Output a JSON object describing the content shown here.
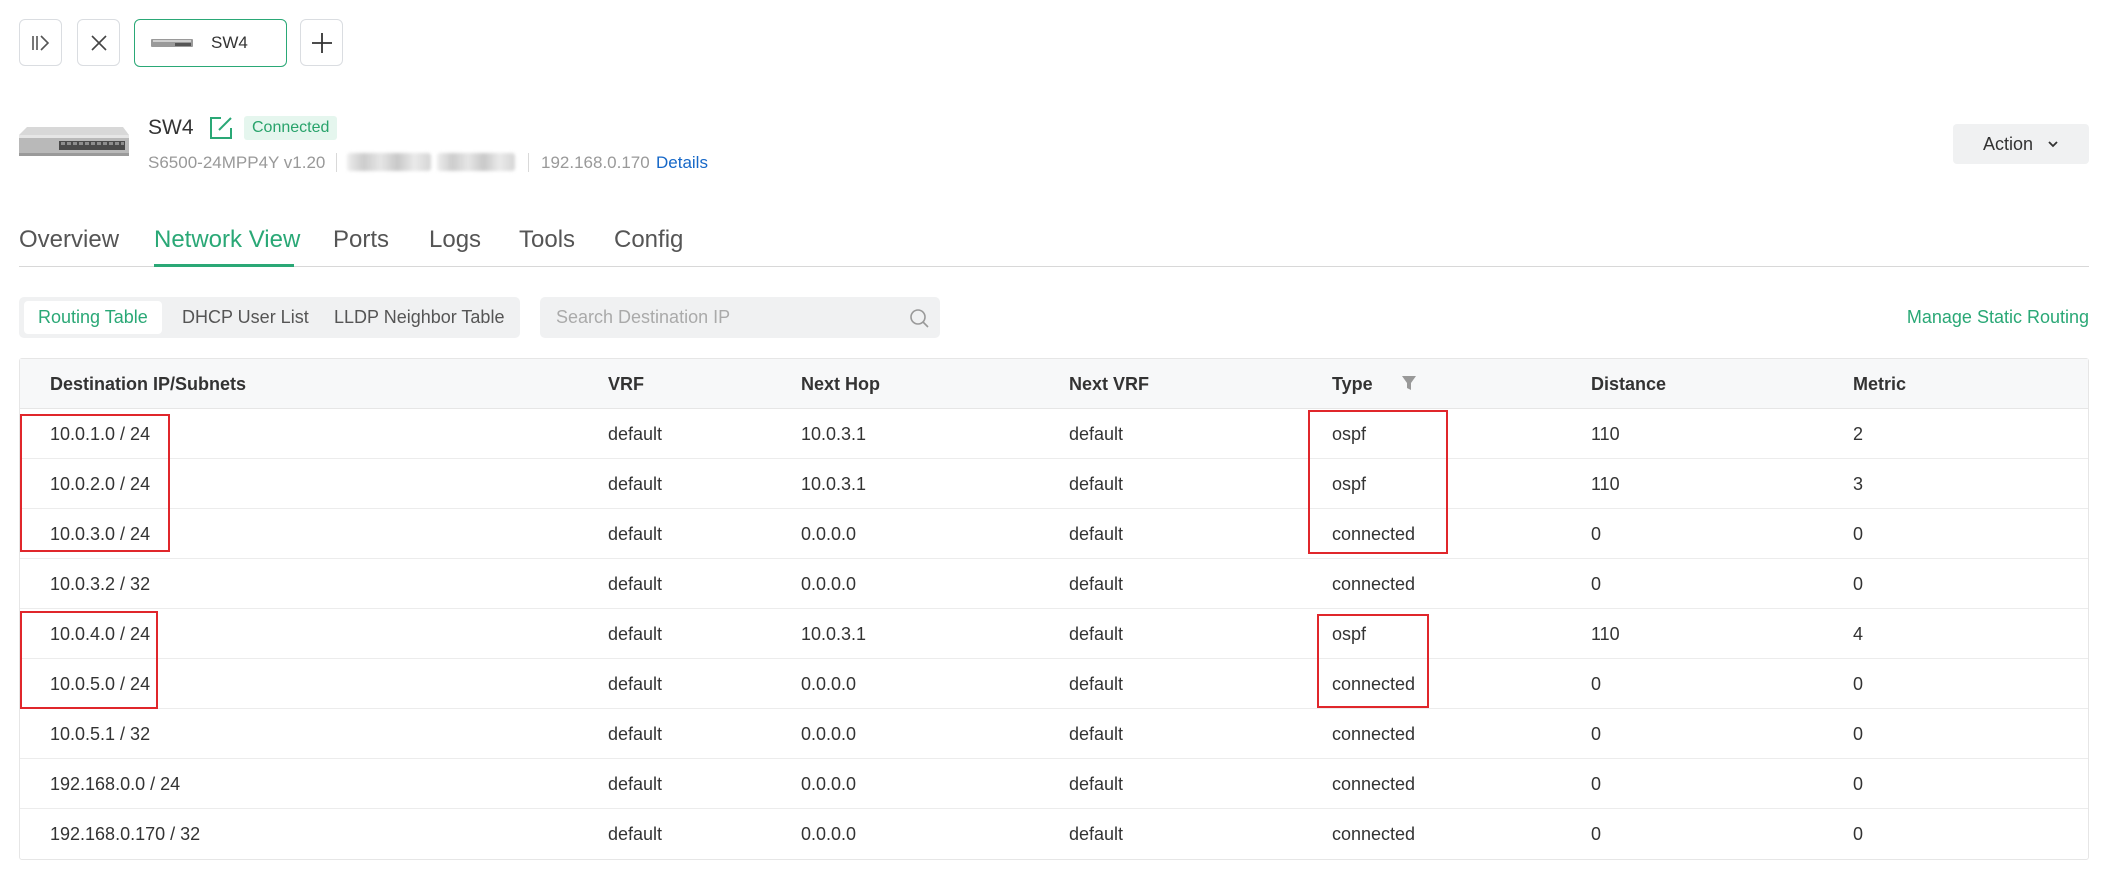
{
  "tabstrip": {
    "device_tab_label": "SW4"
  },
  "device": {
    "name": "SW4",
    "status": "Connected",
    "model": "S6500-24MPP4Y v1.20",
    "ip": "192.168.0.170",
    "details_label": "Details",
    "action_label": "Action"
  },
  "main_tabs": [
    {
      "label": "Overview"
    },
    {
      "label": "Network View"
    },
    {
      "label": "Ports"
    },
    {
      "label": "Logs"
    },
    {
      "label": "Tools"
    },
    {
      "label": "Config"
    }
  ],
  "sub_tabs": [
    {
      "label": "Routing Table"
    },
    {
      "label": "DHCP User List"
    },
    {
      "label": "LLDP Neighbor Table"
    }
  ],
  "search": {
    "placeholder": "Search Destination IP",
    "value": ""
  },
  "manage_static_routing_label": "Manage Static Routing",
  "table": {
    "columns": [
      "Destination IP/Subnets",
      "VRF",
      "Next Hop",
      "Next VRF",
      "Type",
      "Distance",
      "Metric"
    ],
    "rows": [
      [
        "10.0.1.0 / 24",
        "default",
        "10.0.3.1",
        "default",
        "ospf",
        "110",
        "2"
      ],
      [
        "10.0.2.0 / 24",
        "default",
        "10.0.3.1",
        "default",
        "ospf",
        "110",
        "3"
      ],
      [
        "10.0.3.0 / 24",
        "default",
        "0.0.0.0",
        "default",
        "connected",
        "0",
        "0"
      ],
      [
        "10.0.3.2 / 32",
        "default",
        "0.0.0.0",
        "default",
        "connected",
        "0",
        "0"
      ],
      [
        "10.0.4.0 / 24",
        "default",
        "10.0.3.1",
        "default",
        "ospf",
        "110",
        "4"
      ],
      [
        "10.0.5.0 / 24",
        "default",
        "0.0.0.0",
        "default",
        "connected",
        "0",
        "0"
      ],
      [
        "10.0.5.1 / 32",
        "default",
        "0.0.0.0",
        "default",
        "connected",
        "0",
        "0"
      ],
      [
        "192.168.0.0 / 24",
        "default",
        "0.0.0.0",
        "default",
        "connected",
        "0",
        "0"
      ],
      [
        "192.168.0.170 / 32",
        "default",
        "0.0.0.0",
        "default",
        "connected",
        "0",
        "0"
      ]
    ]
  },
  "colors": {
    "accent": "#2aa876",
    "link": "#1668c8",
    "highlight_box": "#e0262b",
    "badge_bg": "#e5f6ee"
  },
  "icons": [
    "collapse-panel-icon",
    "close-icon",
    "switch-thumbnail-icon",
    "add-icon",
    "switch-device-icon",
    "edit-icon",
    "chevron-down-icon",
    "search-icon",
    "filter-icon"
  ]
}
